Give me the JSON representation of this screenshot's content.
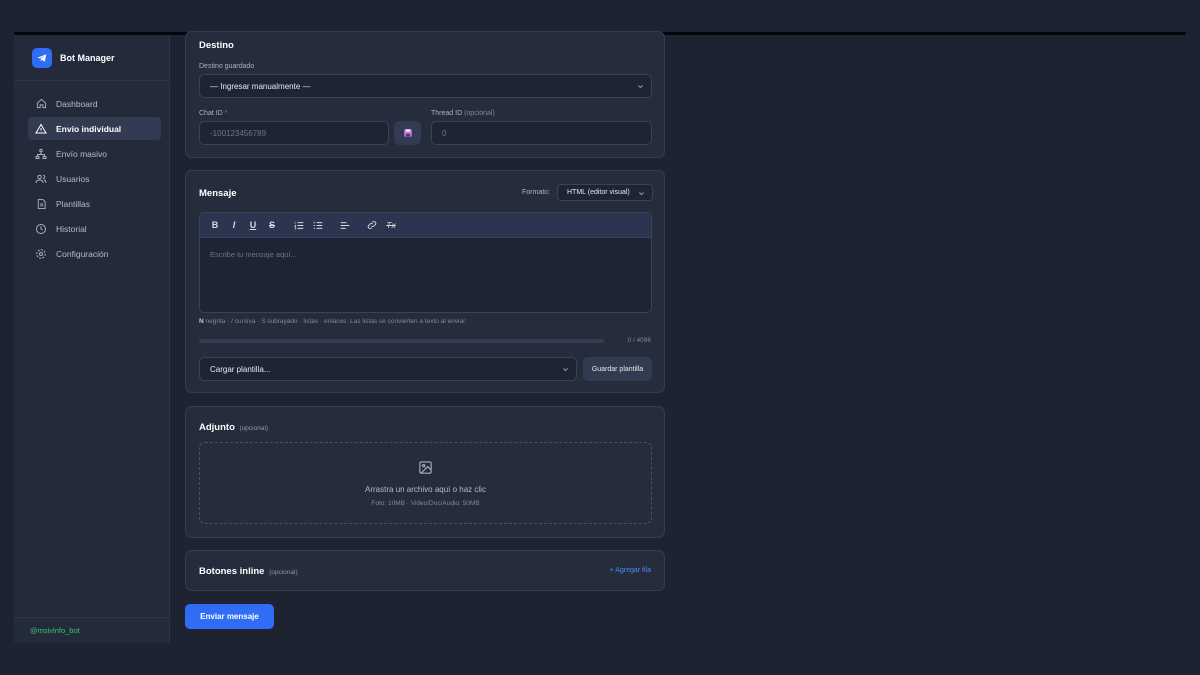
{
  "sidebar": {
    "app_name": "Bot Manager",
    "logo_icon": "telegram-icon",
    "items": [
      {
        "label": "Dashboard",
        "icon": "home-icon"
      },
      {
        "label": "Envío individual",
        "icon": "warning-triangle-icon",
        "active": true
      },
      {
        "label": "Envío masivo",
        "icon": "network-icon"
      },
      {
        "label": "Usuarios",
        "icon": "users-icon"
      },
      {
        "label": "Plantillas",
        "icon": "document-icon"
      },
      {
        "label": "Historial",
        "icon": "clock-icon"
      },
      {
        "label": "Configuración",
        "icon": "gear-icon"
      }
    ],
    "footer_username": "@msivlnfo_bot"
  },
  "destino": {
    "title": "Destino",
    "saved_label": "Destino guardado",
    "saved_value": "— Ingresar manualmente —",
    "chat_id_label": "Chat ID",
    "required_mark": "*",
    "chat_id_placeholder": "-100123456789",
    "thread_id_label": "Thread ID",
    "thread_id_optional": "(opcional)",
    "thread_id_placeholder": "0"
  },
  "mensaje": {
    "title": "Mensaje",
    "format_label": "Formato:",
    "format_value": "HTML (editor visual)",
    "toolbar": [
      {
        "label": "B",
        "icon": "bold-icon"
      },
      {
        "label": "I",
        "icon": "italic-icon"
      },
      {
        "label": "U",
        "icon": "underline-icon"
      },
      {
        "label": "S",
        "icon": "strikethrough-icon"
      },
      {
        "icon": "ordered-list-icon"
      },
      {
        "icon": "bullet-list-icon"
      },
      {
        "icon": "align-left-icon"
      },
      {
        "icon": "link-icon"
      },
      {
        "label": "Tx",
        "icon": "clear-format-icon"
      }
    ],
    "editor_placeholder": "Escribe tu mensaje aquí...",
    "hint_bold": "N",
    "hint_rest": "negrita · / cursiva · S subrayado · listas · enlaces. Las listas se convierten a texto al enviar.",
    "counter": "0 / 4096",
    "progress_fraction": 0,
    "template_placeholder": "Cargar plantilla...",
    "save_template_label": "Guardar plantilla"
  },
  "adjunto": {
    "title": "Adjunto",
    "optional": "(opcional)",
    "dropzone_icon": "image-icon",
    "dropzone_text": "Arrastra un archivo aquí o haz clic",
    "dropzone_limits": "Foto: 10MB · Video/Doc/Audio: 50MB"
  },
  "botones": {
    "title": "Botones inline",
    "optional": "(opcional)",
    "add_row_label": "+ Agregar fila"
  },
  "send_button_label": "Enviar mensaje",
  "colors": {
    "accent": "#2f6df6",
    "background": "#1e2332",
    "card": "#252c3c",
    "username": "#43c26e",
    "required": "#ef5350"
  }
}
